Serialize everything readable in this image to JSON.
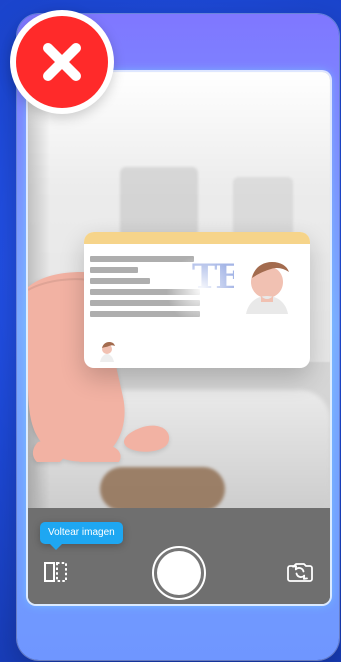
{
  "tooltip": {
    "flip_image_label": "Voltear imagen"
  },
  "colors": {
    "error_red": "#ff2a2a",
    "tooltip_blue": "#1ea7f2",
    "card_header": "#f6d48a",
    "phone_gradient_top": "#7f77ff",
    "phone_gradient_bottom": "#6f96ff"
  },
  "icons": {
    "error": "close-icon",
    "flip": "flip-image-icon",
    "switch_camera": "switch-camera-icon",
    "shutter": "camera-shutter-icon"
  }
}
